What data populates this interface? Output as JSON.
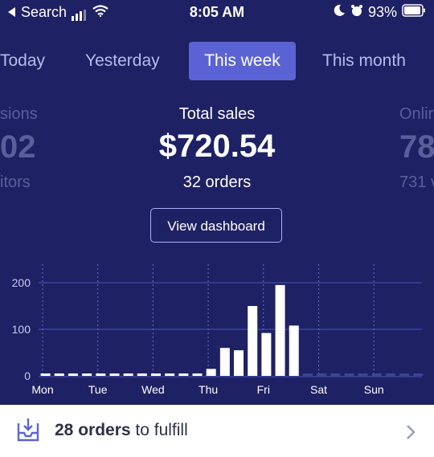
{
  "status_bar": {
    "back_label": "Search",
    "time": "8:05 AM",
    "battery": "93%"
  },
  "tabs": [
    "Today",
    "Yesterday",
    "This week",
    "This month"
  ],
  "active_tab": "This week",
  "left_metric": {
    "label": "sions",
    "value": "02",
    "sub": "itors"
  },
  "main_metric": {
    "label": "Total sales",
    "value": "$720.54",
    "sub": "32 orders"
  },
  "right_metric": {
    "label": "Onlir",
    "value": "78",
    "sub": "731 v"
  },
  "view_dashboard_label": "View dashboard",
  "chart_data": {
    "type": "bar",
    "categories": [
      "Mon",
      "Tue",
      "Wed",
      "Thu",
      "Fri",
      "Sat",
      "Sun"
    ],
    "ylim": [
      0,
      200
    ],
    "yticks": [
      0,
      100,
      200
    ],
    "bars_per_day": 4,
    "values": [
      1,
      1,
      1,
      1,
      1,
      1,
      1,
      1,
      1,
      1,
      1,
      1,
      15,
      60,
      55,
      150,
      92,
      195,
      108,
      0,
      0,
      0,
      0,
      0,
      0,
      0,
      0,
      0
    ],
    "grid": true
  },
  "fulfill": {
    "count_text": "28 orders",
    "rest_text": " to fulfill"
  }
}
